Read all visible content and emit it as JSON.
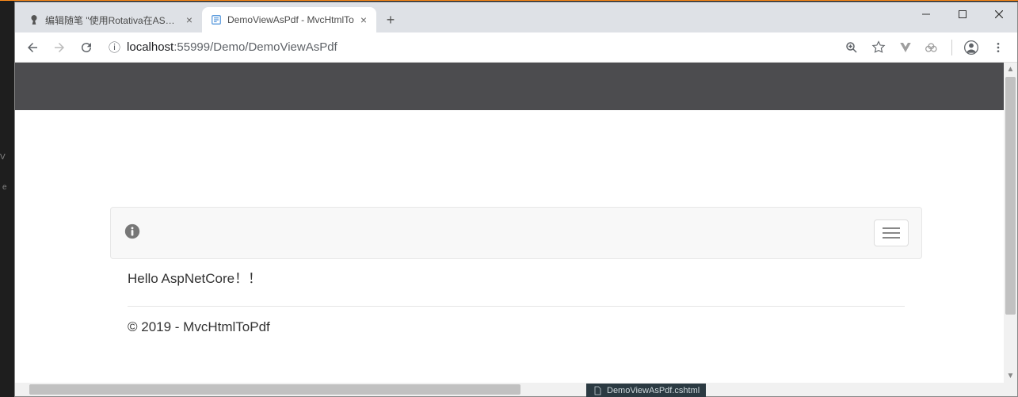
{
  "tabs": [
    {
      "title": "编辑随笔 \"使用Rotativa在ASP.N",
      "active": false
    },
    {
      "title": "DemoViewAsPdf - MvcHtmlTo",
      "active": true
    }
  ],
  "url": {
    "info_icon": "ⓘ",
    "host_prefix": "localhost",
    "host_port": ":55999",
    "path": "/Demo/DemoViewAsPdf"
  },
  "page": {
    "greeting": "Hello AspNetCore！！",
    "footer": "© 2019 - MvcHtmlToPdf"
  },
  "taskbar_file": "DemoViewAsPdf.cshtml"
}
